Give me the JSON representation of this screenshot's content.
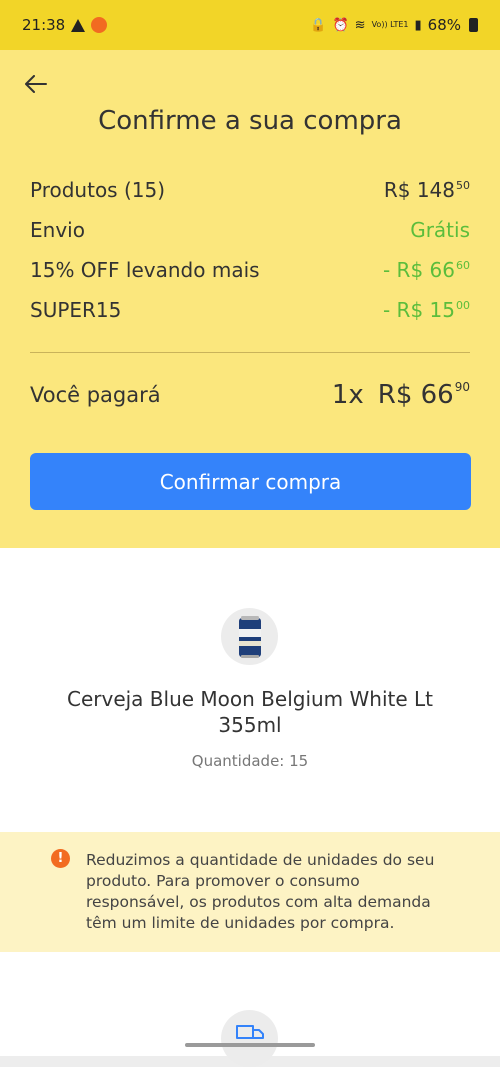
{
  "status_bar": {
    "time": "21:38",
    "network": "Vo)) LTE1",
    "battery": "68%"
  },
  "header": {
    "title": "Confirme a sua compra"
  },
  "summary": {
    "products": {
      "label": "Produtos (15)",
      "value": "R$ 148",
      "cents": "50"
    },
    "shipping": {
      "label": "Envio",
      "value": "Grátis"
    },
    "discount": {
      "label": "15% OFF levando mais",
      "value": "- R$ 66",
      "cents": "60"
    },
    "coupon": {
      "label": "SUPER15",
      "value": "- R$ 15",
      "cents": "00"
    }
  },
  "total": {
    "label": "Você pagará",
    "installments": "1x",
    "value": "R$ 66",
    "cents": "90"
  },
  "confirm_button": {
    "label": "Confirmar compra"
  },
  "product": {
    "name": "Cerveja Blue Moon Belgium White Lt 355ml",
    "quantity": "Quantidade: 15"
  },
  "notice": {
    "text": "Reduzimos a quantidade de unidades do seu produto. Para promover o consumo responsável, os produtos com alta demanda têm um limite de unidades por compra."
  },
  "colors": {
    "header_bg": "#fbe77d",
    "status_bg": "#f2d528",
    "accent_blue": "#3483fa",
    "green": "#5bbd3c",
    "warning_orange": "#f26b21",
    "notice_bg": "#fdf3c4"
  }
}
